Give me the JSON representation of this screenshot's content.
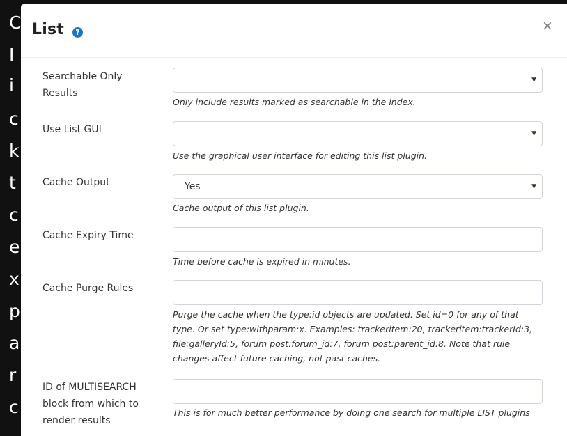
{
  "background_letters": [
    "C",
    "I",
    "i",
    "c",
    "k",
    "t",
    "c",
    "e",
    "x",
    "p",
    "a",
    "r",
    "c"
  ],
  "modal": {
    "title": "List",
    "help_icon": "question-circle-icon",
    "close_label": "×"
  },
  "fields": [
    {
      "label": "Searchable Only Results",
      "value": "",
      "help": "Only include results marked as searchable in the index."
    },
    {
      "label": "Use List GUI",
      "value": "",
      "help": "Use the graphical user interface for editing this list plugin."
    },
    {
      "label": "Cache Output",
      "value": "Yes",
      "help": "Cache output of this list plugin."
    },
    {
      "label": "Cache Expiry Time",
      "value": "",
      "help": "Time before cache is expired in minutes."
    },
    {
      "label": "Cache Purge Rules",
      "value": "",
      "help": "Purge the cache when the type:id objects are updated. Set id=0 for any of that type. Or set type:withparam:x. Examples: trackeritem:20, trackeritem:trackerId:3, file:galleryId:5, forum post:forum_id:7, forum post:parent_id:8. Note that rule changes affect future caching, not past caches."
    },
    {
      "label": "ID of MULTISEARCH block from which to render results",
      "value": "",
      "help": "This is for much better performance by doing one search for multiple LIST plugins"
    }
  ],
  "colors": {
    "accent": "#1a73c8",
    "backdrop": "#111111"
  }
}
